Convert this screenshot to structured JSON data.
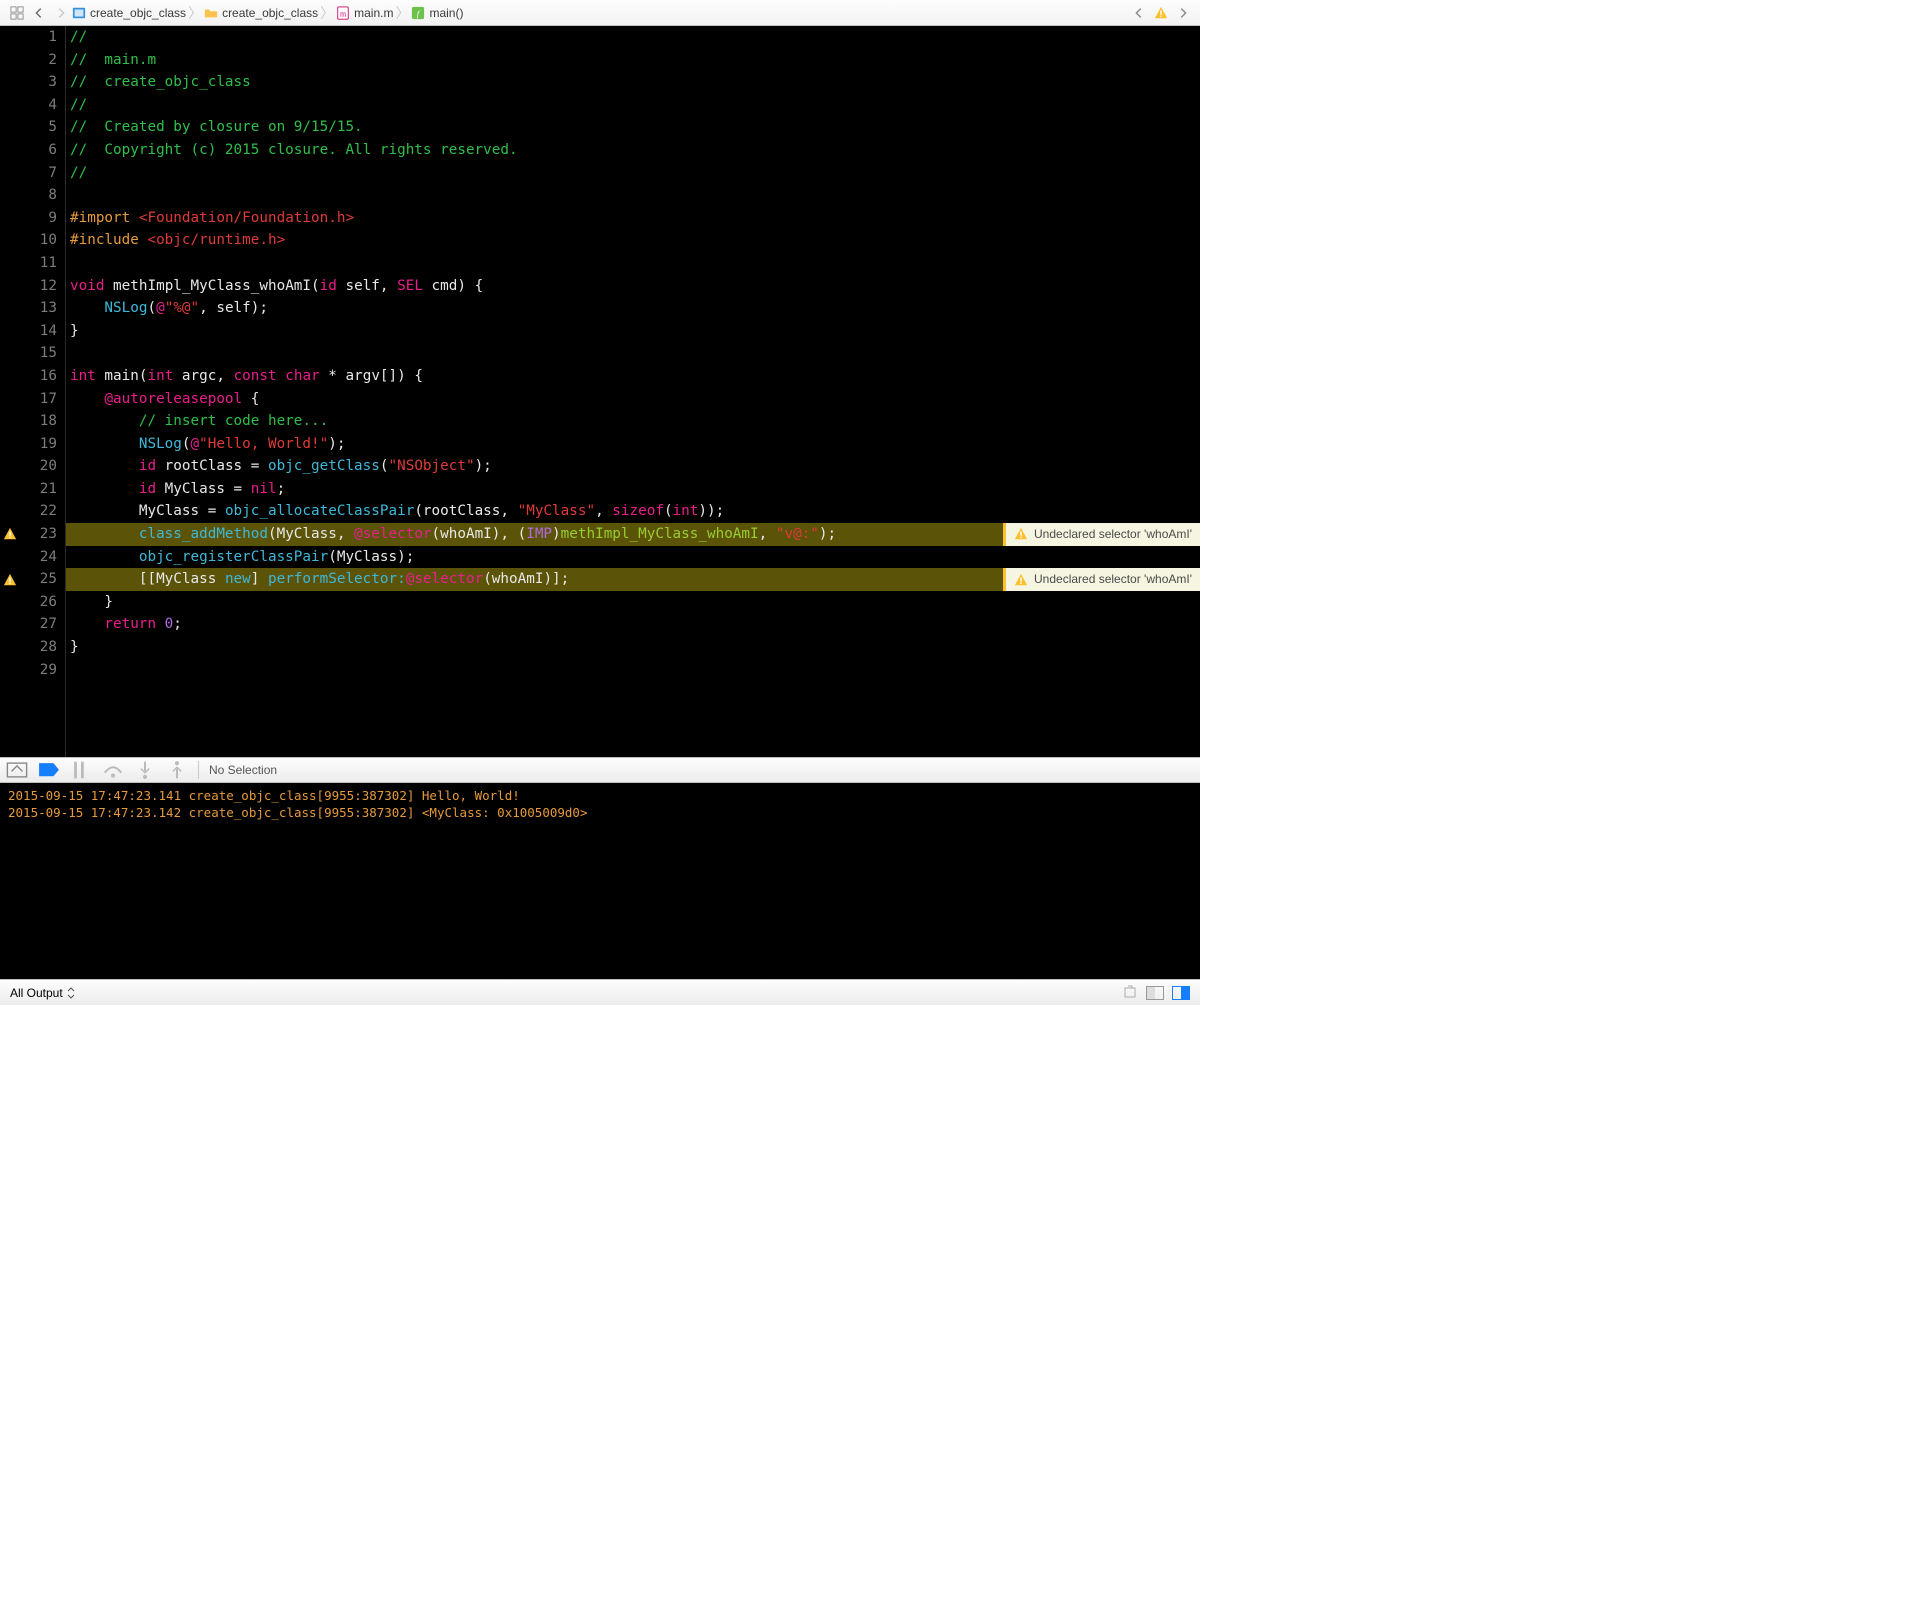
{
  "breadcrumbs": {
    "project": "create_objc_class",
    "folder": "create_objc_class",
    "file": "main.m",
    "symbol": "main()"
  },
  "lines": {
    "count": 29
  },
  "code": {
    "l1": "//",
    "l2": "//  main.m",
    "l3": "//  create_objc_class",
    "l4": "//",
    "l5": "//  Created by closure on 9/15/15.",
    "l6": "//  Copyright (c) 2015 closure. All rights reserved.",
    "l7": "//",
    "l9a": "#import ",
    "l9b": "<Foundation/Foundation.h>",
    "l10a": "#include ",
    "l10b": "<objc/runtime.h>",
    "l12": {
      "void": "void",
      "fn": " methImpl_MyClass_whoAmI",
      "open": "(",
      "id": "id",
      "self": " self, ",
      "SEL": "SEL",
      "rest": " cmd) {"
    },
    "l13": {
      "ns": "    NSLog",
      "open": "(",
      "at": "@",
      "str": "\"%@\"",
      "rest": ", self);"
    },
    "l14": "}",
    "l16": {
      "int1": "int",
      "main": " main(",
      "int2": "int",
      "argc": " argc, ",
      "const": "const",
      "char": " char",
      "star": " *",
      "argv": " argv[]) {"
    },
    "l17": {
      "at": "    @autoreleasepool",
      "brace": " {"
    },
    "l18": "        // insert code here...",
    "l19": {
      "ns": "        NSLog",
      "open": "(",
      "at": "@",
      "str": "\"Hello, World!\"",
      "close": ");"
    },
    "l20": {
      "id": "        id",
      "root": " rootClass = ",
      "fn": "objc_getClass",
      "open": "(",
      "str": "\"NSObject\"",
      "close": ");"
    },
    "l21": {
      "id": "        id",
      "rest": " MyClass = ",
      "nil": "nil",
      "semi": ";"
    },
    "l22": {
      "lhs": "        MyClass = ",
      "fn": "objc_allocateClassPair",
      "open": "(rootClass, ",
      "str": "\"MyClass\"",
      "comma": ", ",
      "sizeof": "sizeof",
      "open2": "(",
      "int": "int",
      "close": "));"
    },
    "l23": {
      "fn": "        class_addMethod",
      "open": "(MyClass, ",
      "at": "@selector",
      "open2": "(whoAmI), (",
      "imp": "IMP",
      "close1": ")",
      "fn2": "methImpl_MyClass_whoAmI",
      "comma": ", ",
      "str": "\"v@:\"",
      "close": ");"
    },
    "l24": {
      "fn": "        objc_registerClassPair",
      "rest": "(MyClass);"
    },
    "l25": {
      "open": "        [[MyClass ",
      "new": "new",
      "mid": "] ",
      "sel": "performSelector:",
      "at": "@selector",
      "open2": "(whoAmI)];"
    },
    "l26": "    }",
    "l27": {
      "ret": "    return",
      "zero": " 0",
      "semi": ";"
    },
    "l28": "}"
  },
  "warnings": {
    "line23": "Undeclared selector 'whoAmI'",
    "line25": "Undeclared selector 'whoAmI'"
  },
  "debug_toolbar": {
    "no_selection": "No Selection"
  },
  "console": {
    "l1": "2015-09-15 17:47:23.141 create_objc_class[9955:387302] Hello, World!",
    "l2": "2015-09-15 17:47:23.142 create_objc_class[9955:387302] <MyClass: 0x1005009d0>"
  },
  "bottom": {
    "filter": "All Output",
    "updown": "▾"
  }
}
